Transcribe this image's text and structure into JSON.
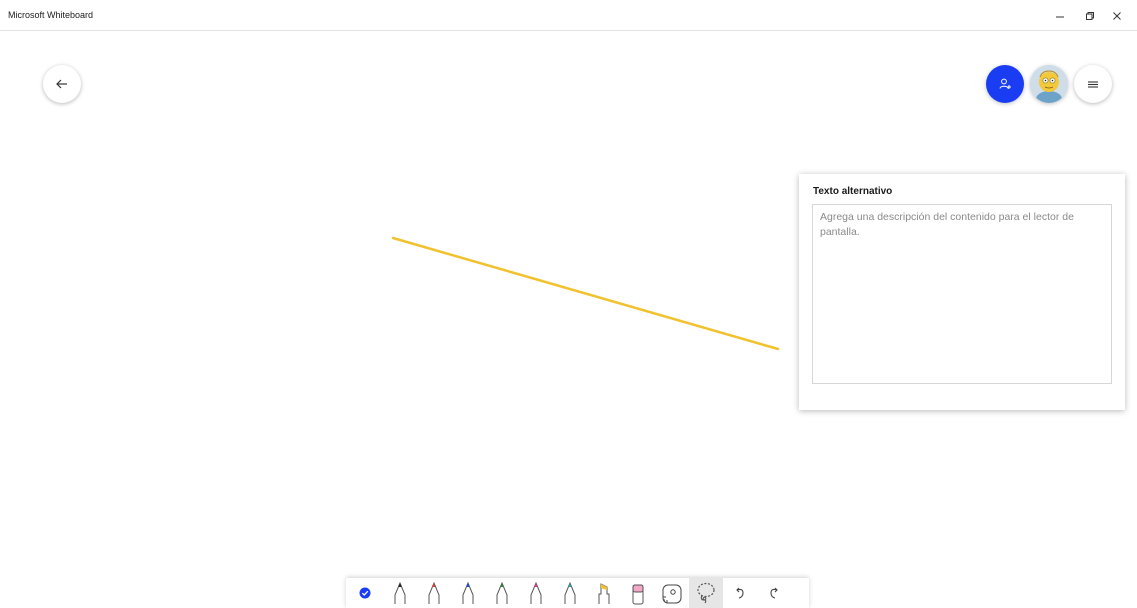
{
  "window": {
    "title": "Microsoft Whiteboard",
    "minimize_glyph": "–",
    "restore_glyph": "restore-icon",
    "close_glyph": "×"
  },
  "header": {
    "back_icon": "arrow-left-icon",
    "share_icon": "add-person-icon",
    "avatar_icon": "user-avatar",
    "menu_icon": "hamburger-icon"
  },
  "canvas": {
    "stroke_color": "#f2c12e"
  },
  "alt_text_panel": {
    "title": "Texto alternativo",
    "placeholder": "Agrega una descripción del contenido para el lector de pantalla.",
    "value": ""
  },
  "toolbar": {
    "tools": [
      {
        "name": "select-tool",
        "icon": "check-circle-icon",
        "color": "#1a3cf2"
      },
      {
        "name": "pen-black",
        "icon": "pen-icon",
        "color": "#222222"
      },
      {
        "name": "pen-red",
        "icon": "pen-icon",
        "color": "#e03c31"
      },
      {
        "name": "pen-blue",
        "icon": "pen-icon",
        "color": "#1f4ecf"
      },
      {
        "name": "pen-green",
        "icon": "pen-icon",
        "color": "#2b8a3e"
      },
      {
        "name": "pen-pink",
        "icon": "pen-icon",
        "color": "#d43c8a"
      },
      {
        "name": "pen-teal",
        "icon": "pen-icon",
        "color": "#1fa59a"
      },
      {
        "name": "highlighter",
        "icon": "highlighter-icon",
        "color": "#f2c12e"
      },
      {
        "name": "eraser",
        "icon": "eraser-icon",
        "color": "#f3a8c8"
      },
      {
        "name": "ruler",
        "icon": "ruler-icon",
        "color": "#444444"
      },
      {
        "name": "lasso",
        "icon": "lasso-icon",
        "color": "#555555",
        "active": true
      },
      {
        "name": "undo",
        "icon": "undo-icon",
        "color": "#444444"
      },
      {
        "name": "redo",
        "icon": "redo-icon",
        "color": "#444444"
      }
    ]
  }
}
